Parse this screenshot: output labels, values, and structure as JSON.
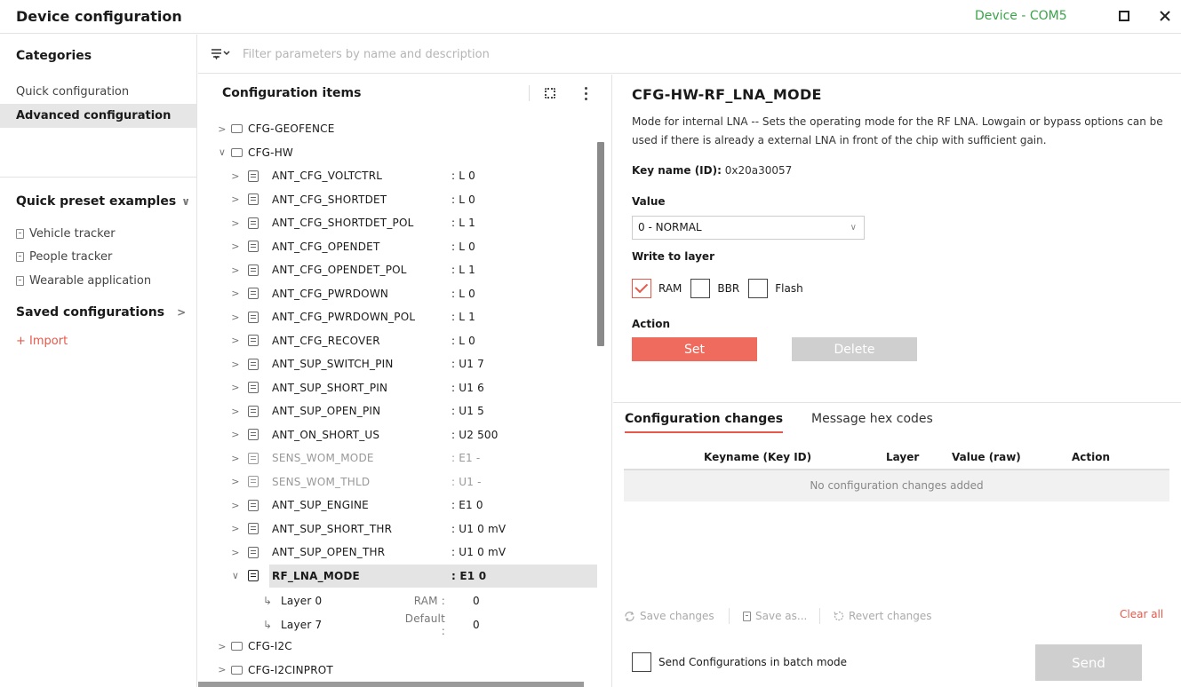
{
  "window": {
    "title": "Device configuration",
    "device_status": "Device - COM5"
  },
  "sidebar": {
    "categories_heading": "Categories",
    "categories": [
      {
        "label": "Quick configuration",
        "active": false
      },
      {
        "label": "Advanced configuration",
        "active": true
      }
    ],
    "presets_heading": "Quick preset examples",
    "presets": [
      "Vehicle tracker",
      "People tracker",
      "Wearable application"
    ],
    "saved_heading": "Saved configurations",
    "import_label": "+ Import"
  },
  "filter": {
    "placeholder": "Filter parameters by name and description"
  },
  "tree": {
    "heading": "Configuration items",
    "groups_top": [
      "CFG-GEOFENCE",
      "CFG-HW"
    ],
    "items": [
      {
        "name": "ANT_CFG_VOLTCTRL",
        "type": ": L  0",
        "disabled": false
      },
      {
        "name": "ANT_CFG_SHORTDET",
        "type": ": L  0",
        "disabled": false
      },
      {
        "name": "ANT_CFG_SHORTDET_POL",
        "type": ": L  1",
        "disabled": false
      },
      {
        "name": "ANT_CFG_OPENDET",
        "type": ": L  0",
        "disabled": false
      },
      {
        "name": "ANT_CFG_OPENDET_POL",
        "type": ": L  1",
        "disabled": false
      },
      {
        "name": "ANT_CFG_PWRDOWN",
        "type": ": L  0",
        "disabled": false
      },
      {
        "name": "ANT_CFG_PWRDOWN_POL",
        "type": ": L  1",
        "disabled": false
      },
      {
        "name": "ANT_CFG_RECOVER",
        "type": ": L  0",
        "disabled": false
      },
      {
        "name": "ANT_SUP_SWITCH_PIN",
        "type": ": U1  7",
        "disabled": false
      },
      {
        "name": "ANT_SUP_SHORT_PIN",
        "type": ": U1  6",
        "disabled": false
      },
      {
        "name": "ANT_SUP_OPEN_PIN",
        "type": ": U1  5",
        "disabled": false
      },
      {
        "name": "ANT_ON_SHORT_US",
        "type": ": U2  500",
        "disabled": false
      },
      {
        "name": "SENS_WOM_MODE",
        "type": ": E1  -",
        "disabled": true
      },
      {
        "name": "SENS_WOM_THLD",
        "type": ": U1  -",
        "disabled": true
      },
      {
        "name": "ANT_SUP_ENGINE",
        "type": ": E1  0",
        "disabled": false
      },
      {
        "name": "ANT_SUP_SHORT_THR",
        "type": ": U1  0 mV",
        "disabled": false
      },
      {
        "name": "ANT_SUP_OPEN_THR",
        "type": ": U1  0 mV",
        "disabled": false
      },
      {
        "name": "RF_LNA_MODE",
        "type": ": E1  0",
        "disabled": false
      }
    ],
    "layers": [
      {
        "name": "Layer 0",
        "label": "RAM :",
        "value": "0"
      },
      {
        "name": "Layer 7",
        "label": "Default :",
        "value": "0"
      }
    ],
    "groups_bottom": [
      "CFG-I2C",
      "CFG-I2CINPROT"
    ]
  },
  "detail": {
    "title": "CFG-HW-RF_LNA_MODE",
    "description": "Mode for internal LNA -- Sets the operating mode for the RF LNA. Lowgain or bypass options can be used if there is already a external LNA in front of the chip with sufficient gain.",
    "key_label": "Key name (ID):",
    "key_value": "0x20a30057",
    "value_label": "Value",
    "value_selected": "0 - NORMAL",
    "layer_label": "Write to layer",
    "layers": [
      {
        "label": "RAM",
        "checked": true
      },
      {
        "label": "BBR",
        "checked": false
      },
      {
        "label": "Flash",
        "checked": false
      }
    ],
    "action_label": "Action",
    "set_label": "Set",
    "delete_label": "Delete"
  },
  "changes": {
    "tabs": [
      "Configuration changes",
      "Message hex codes"
    ],
    "columns": [
      "Keyname (Key ID)",
      "Layer",
      "Value (raw)",
      "Action"
    ],
    "empty_text": "No configuration changes added",
    "save_label": "Save changes",
    "save_as_label": "Save as...",
    "revert_label": "Revert changes",
    "clear_label": "Clear all",
    "batch_label": "Send Configurations in batch mode",
    "send_label": "Send"
  },
  "colors": {
    "accent": "#ef6b5d",
    "status_green": "#3aa34a",
    "disabled_button": "#cfcfcf"
  }
}
